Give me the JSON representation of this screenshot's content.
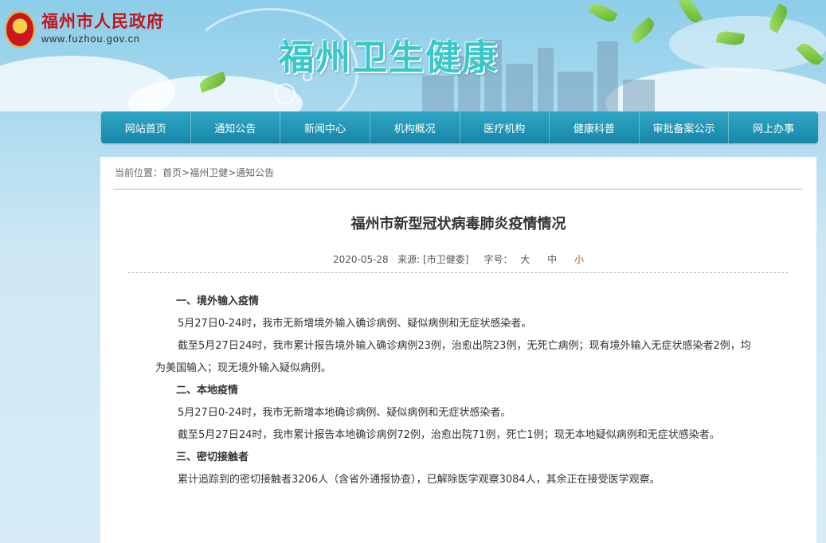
{
  "header": {
    "gov_name": "福州市人民政府",
    "gov_url": "www.fuzhou.gov.cn",
    "site_title": "福州卫生健康"
  },
  "nav": {
    "items": [
      "网站首页",
      "通知公告",
      "新闻中心",
      "机构概况",
      "医疗机构",
      "健康科普",
      "审批备案公示",
      "网上办事"
    ]
  },
  "breadcrumb": {
    "prefix": "当前位置：",
    "items": [
      "首页",
      "福州卫健",
      "通知公告"
    ],
    "sep": ">"
  },
  "article": {
    "title": "福州市新型冠状病毒肺炎疫情情况",
    "date": "2020-05-28",
    "source_label": "来源:",
    "source": "[市卫健委]",
    "font_size_label": "字号：",
    "font_sizes": [
      "大",
      "中",
      "小"
    ],
    "paragraphs": [
      {
        "type": "heading",
        "text": "一、境外输入疫情"
      },
      {
        "type": "para",
        "text": "5月27日0-24时，我市无新增境外输入确诊病例、疑似病例和无症状感染者。"
      },
      {
        "type": "para",
        "text": "截至5月27日24时，我市累计报告境外输入确诊病例23例，治愈出院23例，无死亡病例；现有境外输入无症状感染者2例，均为美国输入；现无境外输入疑似病例。"
      },
      {
        "type": "heading",
        "text": "二、本地疫情"
      },
      {
        "type": "para",
        "text": "5月27日0-24时，我市无新增本地确诊病例、疑似病例和无症状感染者。"
      },
      {
        "type": "para",
        "text": "截至5月27日24时，我市累计报告本地确诊病例72例，治愈出院71例，死亡1例；现无本地疑似病例和无症状感染者。"
      },
      {
        "type": "heading",
        "text": "三、密切接触者"
      },
      {
        "type": "para",
        "text": "累计追踪到的密切接触者3206人（含省外通报协查），已解除医学观察3084人，其余正在接受医学观察。"
      }
    ]
  },
  "colors": {
    "nav_bg": "#1f95b7",
    "title_accent": "#39c7c9",
    "gov_red": "#c2161b",
    "active_font_size": "#c9482a"
  }
}
